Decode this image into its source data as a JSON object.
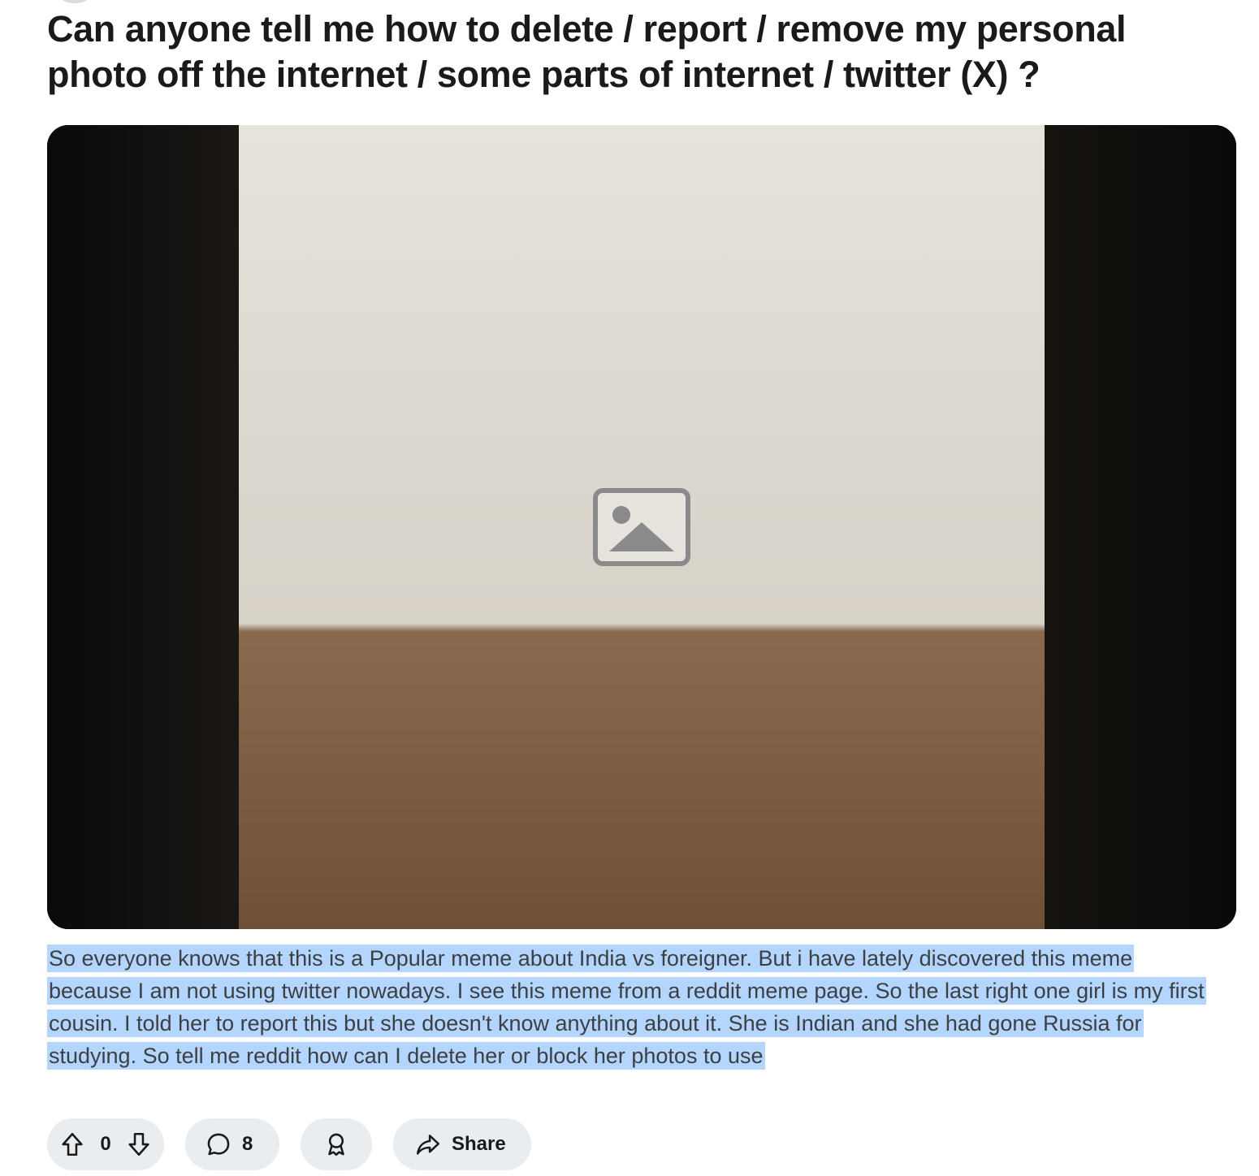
{
  "post": {
    "title": "Can anyone tell me how to delete / report / remove my personal photo off the internet / some parts of internet / twitter (X) ?",
    "body": "So everyone knows that this is a Popular meme about India vs foreigner. But i have lately discovered this meme because I am not using twitter nowadays. I see this meme from a reddit meme page. So the last right one girl is my first cousin. I told her to report this but she doesn't know anything about it. She is Indian and she had gone Russia for studying. So tell me reddit how can I delete her or block her photos to use",
    "body_selected": true
  },
  "media": {
    "icon": "image-placeholder-icon"
  },
  "actions": {
    "vote_count": "0",
    "comment_count": "8",
    "share_label": "Share"
  },
  "icons": {
    "upvote": "upvote-icon",
    "downvote": "downvote-icon",
    "comment": "comment-icon",
    "award": "award-icon",
    "share": "share-icon"
  },
  "colors": {
    "pill_bg": "#eaedef",
    "selection_highlight": "#b4d5fe",
    "title_text": "#1a1a1b",
    "body_text": "#3c4043"
  }
}
